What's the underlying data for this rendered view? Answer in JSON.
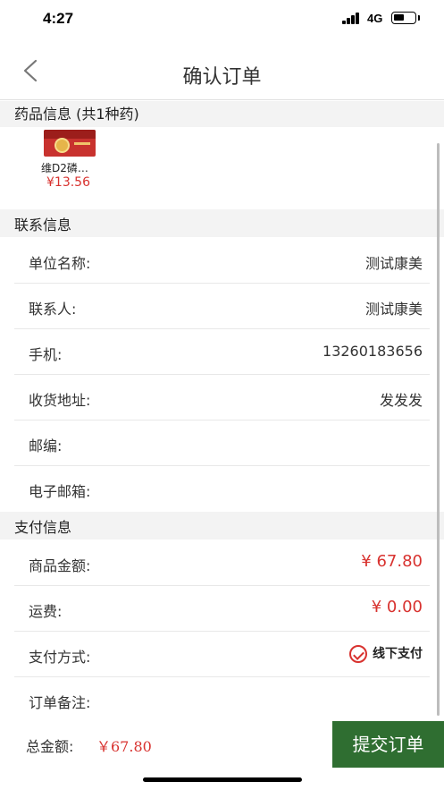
{
  "status_bar": {
    "time": "4:27",
    "network": "4G"
  },
  "nav": {
    "title": "确认订单",
    "back_icon": "chevron-left-icon"
  },
  "sections": {
    "drug_info": "药品信息 (共1种药)",
    "contact_info": "联系信息",
    "payment_info": "支付信息"
  },
  "product": {
    "name": "维D2磷…",
    "price": "¥13.56"
  },
  "contact": {
    "rows": [
      {
        "label": "单位名称:",
        "value": "测试康美"
      },
      {
        "label": "联系人:",
        "value": "测试康美"
      },
      {
        "label": "手机:",
        "value": "13260183656"
      },
      {
        "label": "收货地址:",
        "value": "发发发"
      },
      {
        "label": "邮编:",
        "value": ""
      },
      {
        "label": "电子邮箱:",
        "value": ""
      }
    ]
  },
  "payment": {
    "goods_amount_label": "商品金额:",
    "goods_amount": "¥ 67.80",
    "shipping_label": "运费:",
    "shipping": "¥ 0.00",
    "method_label": "支付方式:",
    "method": "线下支付",
    "remark_label": "订单备注:",
    "remark": ""
  },
  "footer": {
    "total_label": "总金额:",
    "total_value": "￥67.80",
    "submit_label": "提交订单"
  },
  "colors": {
    "accent_red": "#d8322f",
    "submit_green": "#2f6e31",
    "section_bg": "#f3f3f3"
  }
}
